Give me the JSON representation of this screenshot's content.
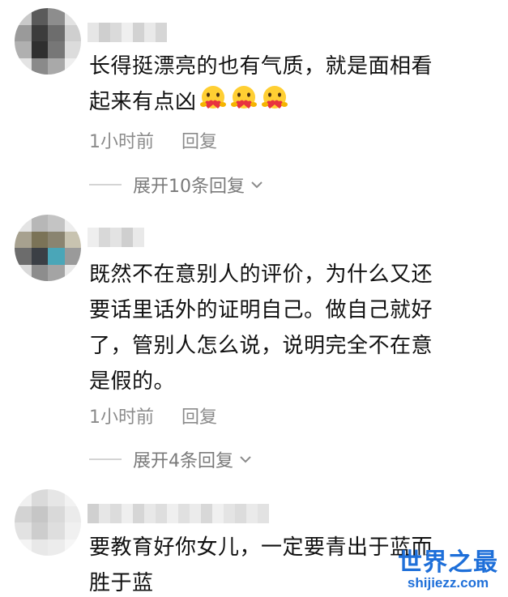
{
  "comments": [
    {
      "text_line1": "长得挺漂亮的也有气质，就是面相看",
      "text_line2": "起来有点凶",
      "emojis": [
        "hug-heart-emoji",
        "hug-heart-emoji",
        "hug-heart-emoji"
      ],
      "time": "1小时前",
      "reply_label": "回复",
      "expand_label": "展开10条回复"
    },
    {
      "text_line1": "既然不在意别人的评价，为什么又还",
      "text_line2": "要话里话外的证明自己。做自己就好",
      "text_line3": "了，管别人怎么说，说明完全不在意",
      "text_line4": "是假的。",
      "time": "1小时前",
      "reply_label": "回复",
      "expand_label": "展开4条回复"
    },
    {
      "text_line1": "要教育好你女儿，一定要青出于蓝而",
      "text_line2": "胜于蓝"
    }
  ],
  "watermark": {
    "main": "世界之最",
    "url": "shijiezz.com"
  },
  "colors": {
    "text": "#111111",
    "meta": "#8b8b8b",
    "watermark": "#1e6fd9"
  }
}
